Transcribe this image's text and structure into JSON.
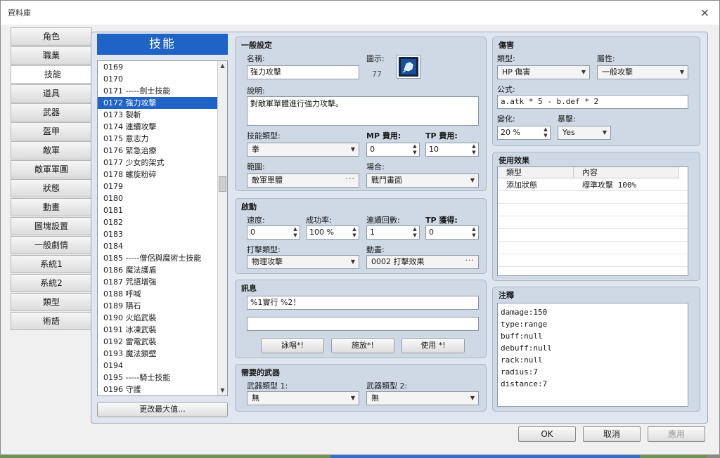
{
  "window": {
    "title": "資料庫"
  },
  "categories": [
    "角色",
    "職業",
    "技能",
    "道具",
    "武器",
    "盔甲",
    "敵軍",
    "敵軍軍團",
    "狀態",
    "動畫",
    "圖塊設置",
    "一般劇情",
    "系統1",
    "系統2",
    "類型",
    "術語"
  ],
  "active_category": "技能",
  "list": {
    "header": "技能",
    "items": [
      "0169",
      "0170",
      "0171 -----劍士技能",
      "0172 強力攻擊",
      "0173 裂斬",
      "0174 連續攻擊",
      "0175 意志力",
      "0176 緊急治療",
      "0177 少女的架式",
      "0178 螺旋粉碎",
      "0179",
      "0180",
      "0181",
      "0182",
      "0183",
      "0184",
      "0185 -----僧侶與魔術士技能",
      "0186 魔法護盾",
      "0187 咒語增強",
      "0188 呼喊",
      "0189 隕石",
      "0190 火焰武裝",
      "0191 冰凍武裝",
      "0192 雷電武裝",
      "0193 魔法鎖壁",
      "0194",
      "0195 -----騎士技能",
      "0196 守護"
    ],
    "selected_index": 3,
    "change_max_button": "更改最大值..."
  },
  "general": {
    "title": "一般設定",
    "name_label": "名稱:",
    "name_value": "強力攻擊",
    "icon_label": "圖示:",
    "icon_index": "77",
    "desc_label": "說明:",
    "desc_value": "對敵軍單體進行強力攻擊。",
    "skill_type_label": "技能類型:",
    "skill_type_value": "拳",
    "mp_label": "MP 費用:",
    "mp_value": "0",
    "tp_label": "TP 費用:",
    "tp_value": "10",
    "scope_label": "範圍:",
    "scope_value": "敵軍單體",
    "occasion_label": "場合:",
    "occasion_value": "戰鬥畫面"
  },
  "invocation": {
    "title": "啟動",
    "speed_label": "速度:",
    "speed_value": "0",
    "success_label": "成功率:",
    "success_value": "100 %",
    "repeat_label": "連續回數:",
    "repeat_value": "1",
    "tpgain_label": "TP 獲得:",
    "tpgain_value": "0",
    "hittype_label": "打擊類型:",
    "hittype_value": "物理攻擊",
    "anim_label": "動畫:",
    "anim_value": "0002 打擊效果"
  },
  "message": {
    "title": "訊息",
    "line1": "%1實行 %2！",
    "line2": "",
    "btn_cast": "詠唱*!",
    "btn_use1": "施放*!",
    "btn_use2": "使用 *!"
  },
  "weapons": {
    "title": "需要的武器",
    "w1_label": "武器類型 1:",
    "w1_value": "無",
    "w2_label": "武器類型 2:",
    "w2_value": "無"
  },
  "damage": {
    "title": "傷害",
    "type_label": "類型:",
    "type_value": "HP 傷害",
    "element_label": "屬性:",
    "element_value": "一般攻擊",
    "formula_label": "公式:",
    "formula_value": "a.atk * 5 - b.def * 2",
    "variance_label": "變化:",
    "variance_value": "20 %",
    "critical_label": "暴擊:",
    "critical_value": "Yes"
  },
  "effects": {
    "title": "使用效果",
    "col_type": "類型",
    "col_content": "內容",
    "rows": [
      {
        "type": "添加狀態",
        "content": "標準攻擊 100%"
      }
    ]
  },
  "notes": {
    "title": "注釋",
    "lines": [
      "damage:150",
      "type:range",
      "buff:null",
      "debuff:null",
      "rack:null",
      "radius:7",
      "distance:7"
    ]
  },
  "footer": {
    "ok": "OK",
    "cancel": "取消",
    "apply": "應用"
  }
}
